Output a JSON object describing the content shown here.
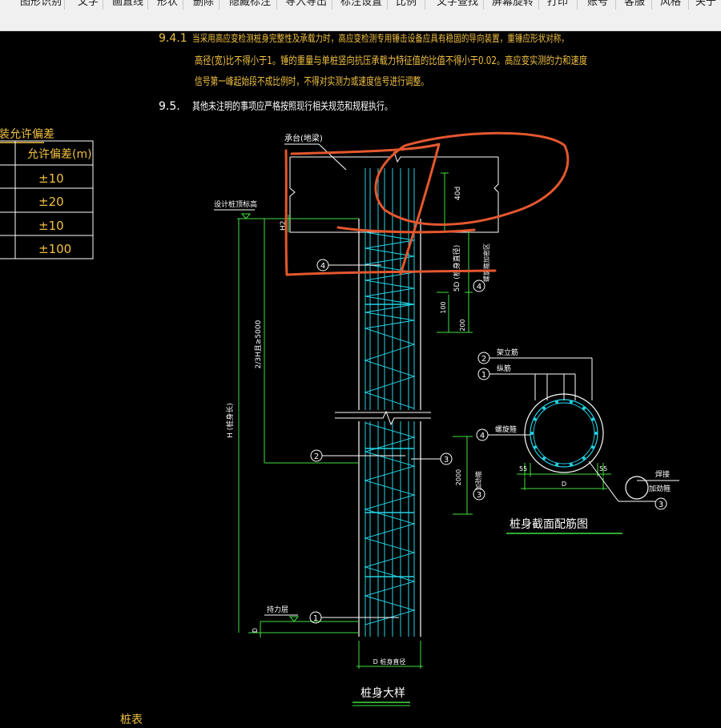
{
  "toolbar": {
    "items": [
      "图形识别",
      "文字",
      "画直线",
      "形状",
      "删除",
      "隐藏标注",
      "导入导出",
      "标注设置",
      "比例",
      "文字查找",
      "屏幕旋转",
      "打印",
      "账号",
      "客服",
      "风格",
      "关于"
    ]
  },
  "notes": {
    "n941_num": "9.4.1",
    "n941_line1": "当采用高应变检测桩身完整性及承载力时，高应变检测专用锤击设备应具有稳固的导向装置，重锤应形状对称，",
    "n941_line2": "高径(宽)比不得小于1。锤的重量与单桩竖向抗压承载力特征值的比值不得小于0.02。高应变实测的力和速度",
    "n941_line3": "信号第一峰起始段不成比例时，不得对实测力或速度信号进行调整。",
    "n95_num": "9.5.",
    "n95_text": "其他未注明的事项应严格按照现行相关规范和规程执行。"
  },
  "tolerance_table": {
    "title": "装允许偏差",
    "header": "允许偏差(m)",
    "rows": [
      "±10",
      "±20",
      "±10",
      "±100"
    ]
  },
  "pile_detail": {
    "cap_label": "承台(地梁)",
    "design_top_label": "设计桩顶标高",
    "h2_label": "H2",
    "embed_label": "40d",
    "spiral_top_label": "5D (桩身直径)",
    "spiral_top_note": "螺旋箍加密区",
    "dim_100": "100",
    "dim_200": "200",
    "length_label": "2/3H且≥5000",
    "total_label": "H (桩身长)",
    "bottom_dim": "2000",
    "bottom_note": "加劲箍",
    "bearing_label": "持力层",
    "bottom_small": "D",
    "width_label": "D 桩身直径",
    "title": "桩身大样",
    "callouts": [
      "1",
      "2",
      "3",
      "4"
    ]
  },
  "section": {
    "label2": "架立筋",
    "label1": "纵筋",
    "label4": "螺旋箍",
    "dim_left": "55",
    "dim_right": "55",
    "dim_d": "D",
    "hoop_label1": "焊接",
    "hoop_label2": "加劲箍",
    "title": "桩身截面配筋图",
    "callouts": [
      "1",
      "2",
      "3",
      "4"
    ]
  },
  "bottom_text": "桩表",
  "colors": {
    "background": "#000000",
    "note_text": "#f0c040",
    "white": "#ffffff",
    "cyan": "#22d3e6",
    "green": "#3fe13f",
    "annotation": "#e4572e"
  }
}
